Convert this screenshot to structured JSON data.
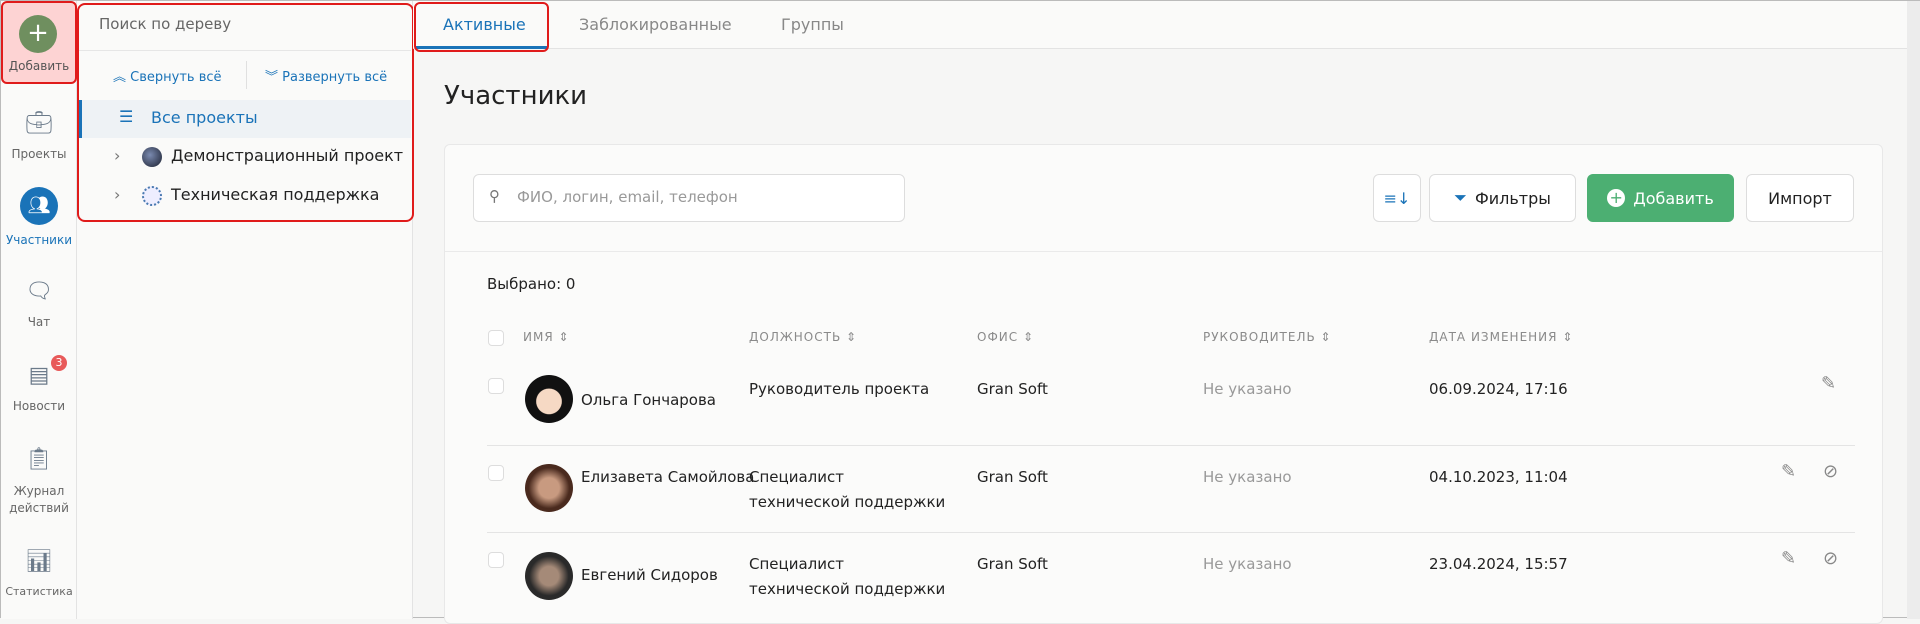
{
  "rail": {
    "add": "Добавить",
    "items": [
      {
        "label": "Проекты"
      },
      {
        "label": "Участники"
      },
      {
        "label": "Чат"
      },
      {
        "label": "Новости",
        "badge": "3"
      },
      {
        "label": "Журнал действий"
      },
      {
        "label": "Статистика"
      }
    ]
  },
  "tree": {
    "search_placeholder": "Поиск по дереву",
    "collapse": "Свернуть всё",
    "expand": "Развернуть всё",
    "items": [
      {
        "label": "Все проекты"
      },
      {
        "label": "Демонстрационный проект"
      },
      {
        "label": "Техническая поддержка"
      }
    ]
  },
  "tabs": [
    {
      "label": "Активные"
    },
    {
      "label": "Заблокированные"
    },
    {
      "label": "Группы"
    }
  ],
  "page": {
    "title": "Участники",
    "search_placeholder": "ФИО, логин, email, телефон",
    "filters": "Фильтры",
    "add": "Добавить",
    "import": "Импорт",
    "selected": "Выбрано: 0"
  },
  "table": {
    "headers": [
      "ИМЯ",
      "ДОЛЖНОСТЬ",
      "ОФИС",
      "РУКОВОДИТЕЛЬ",
      "ДАТА ИЗМЕНЕНИЯ"
    ],
    "rows": [
      {
        "name": "Ольга Гончарова",
        "position": "Руководитель проекта",
        "office": "Gran Soft",
        "manager": "Не указано",
        "date": "06.09.2024, 17:16"
      },
      {
        "name": "Елизавета Самойлова",
        "position": "Специалист технической поддержки",
        "office": "Gran Soft",
        "manager": "Не указано",
        "date": "04.10.2023, 11:04"
      },
      {
        "name": "Евгений Сидоров",
        "position": "Специалист технической поддержки",
        "office": "Gran Soft",
        "manager": "Не указано",
        "date": "23.04.2024, 15:57"
      }
    ]
  },
  "colors": {
    "accent": "#1a73b8",
    "green": "#4caf72",
    "highlight": "#e01b1b"
  }
}
